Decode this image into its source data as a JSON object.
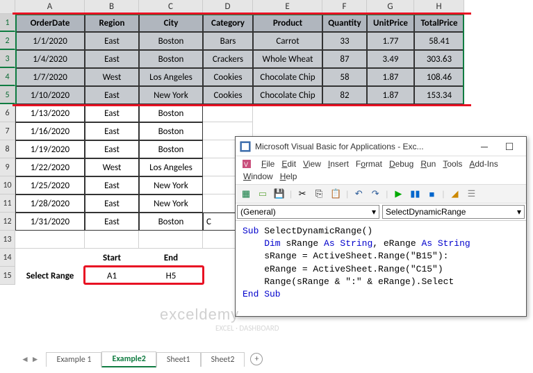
{
  "columns": [
    "A",
    "B",
    "C",
    "D",
    "E",
    "F",
    "G",
    "H"
  ],
  "rows": [
    "1",
    "2",
    "3",
    "4",
    "5",
    "6",
    "7",
    "8",
    "9",
    "10",
    "11",
    "12",
    "13",
    "14",
    "15"
  ],
  "headers": [
    "OrderDate",
    "Region",
    "City",
    "Category",
    "Product",
    "Quantity",
    "UnitPrice",
    "TotalPrice"
  ],
  "data": [
    [
      "1/1/2020",
      "East",
      "Boston",
      "Bars",
      "Carrot",
      "33",
      "1.77",
      "58.41"
    ],
    [
      "1/4/2020",
      "East",
      "Boston",
      "Crackers",
      "Whole Wheat",
      "87",
      "3.49",
      "303.63"
    ],
    [
      "1/7/2020",
      "West",
      "Los Angeles",
      "Cookies",
      "Chocolate Chip",
      "58",
      "1.87",
      "108.46"
    ],
    [
      "1/10/2020",
      "East",
      "New York",
      "Cookies",
      "Chocolate Chip",
      "82",
      "1.87",
      "153.34"
    ],
    [
      "1/13/2020",
      "East",
      "Boston",
      "",
      "",
      "",
      "",
      ""
    ],
    [
      "1/16/2020",
      "East",
      "Boston",
      "",
      "",
      "",
      "",
      ""
    ],
    [
      "1/19/2020",
      "East",
      "Boston",
      "",
      "",
      "",
      "",
      ""
    ],
    [
      "1/22/2020",
      "West",
      "Los Angeles",
      "",
      "",
      "",
      "",
      ""
    ],
    [
      "1/25/2020",
      "East",
      "New York",
      "",
      "",
      "",
      "",
      ""
    ],
    [
      "1/28/2020",
      "East",
      "New York",
      "",
      "",
      "",
      "",
      ""
    ],
    [
      "1/31/2020",
      "East",
      "Boston",
      "C",
      "",
      "",
      "",
      ""
    ]
  ],
  "row14": {
    "start": "Start",
    "end": "End"
  },
  "row15": {
    "label": "Select Range",
    "a1": "A1",
    "h5": "H5"
  },
  "tabs": [
    "Example 1",
    "Example2",
    "Sheet1",
    "Sheet2"
  ],
  "active_tab": "Example2",
  "vba": {
    "title": "Microsoft Visual Basic for Applications - Exc...",
    "menus": [
      "File",
      "Edit",
      "View",
      "Insert",
      "Format",
      "Debug",
      "Run",
      "Tools",
      "Add-Ins",
      "Window",
      "Help"
    ],
    "dd1": "(General)",
    "dd2": "SelectDynamicRange",
    "code": {
      "l1a": "Sub",
      "l1b": " SelectDynamicRange()",
      "l2a": "    Dim",
      "l2b": " sRange ",
      "l2c": "As String",
      "l2d": ", eRange ",
      "l2e": "As String",
      "l3": "    sRange = ActiveSheet.Range(\"B15\"):",
      "l4": "    eRange = ActiveSheet.Range(\"C15\")",
      "l5": "    Range(sRange & \":\" & eRange).Select",
      "l6": "End Sub"
    }
  },
  "watermark": "exceldemy",
  "watermark2": "EXCEL · DASHBOARD"
}
